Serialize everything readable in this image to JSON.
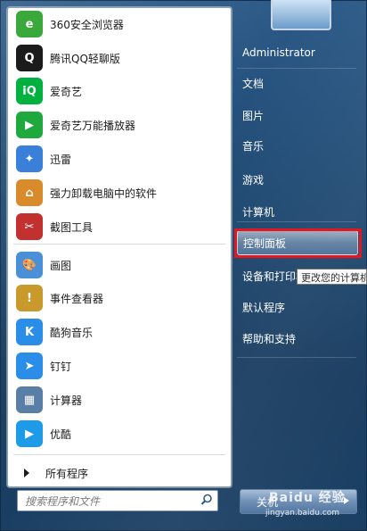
{
  "programs": [
    {
      "label": "360安全浏览器",
      "icon": "browser-360-icon",
      "color": "#3aa83a",
      "glyph": "e"
    },
    {
      "label": "腾讯QQ轻聊版",
      "icon": "qq-penguin-icon",
      "color": "#1b1b1b",
      "glyph": "Q"
    },
    {
      "label": "爱奇艺",
      "icon": "iqiyi-icon",
      "color": "#00b140",
      "glyph": "iQ"
    },
    {
      "label": "爱奇艺万能播放器",
      "icon": "iqiyi-player-icon",
      "color": "#1fa83c",
      "glyph": "▶"
    },
    {
      "label": "迅雷",
      "icon": "thunder-icon",
      "color": "#3a7fd8",
      "glyph": "✦"
    },
    {
      "label": "强力卸载电脑中的软件",
      "icon": "uninstall-icon",
      "color": "#d98a2a",
      "glyph": "⌂"
    },
    {
      "label": "截图工具",
      "icon": "snipping-tool-icon",
      "color": "#c23030",
      "glyph": "✂"
    },
    {
      "label": "画图",
      "icon": "paint-icon",
      "color": "#4a90d9",
      "glyph": "🎨"
    },
    {
      "label": "事件查看器",
      "icon": "event-viewer-icon",
      "color": "#c89a2c",
      "glyph": "!"
    },
    {
      "label": "酷狗音乐",
      "icon": "kugou-icon",
      "color": "#2a8de8",
      "glyph": "K"
    },
    {
      "label": "钉钉",
      "icon": "dingtalk-icon",
      "color": "#2a8de8",
      "glyph": "➤"
    },
    {
      "label": "计算器",
      "icon": "calculator-icon",
      "color": "#5a7fa6",
      "glyph": "▦"
    },
    {
      "label": "优酷",
      "icon": "youku-icon",
      "color": "#1e9be8",
      "glyph": "▶"
    }
  ],
  "all_programs": "所有程序",
  "search": {
    "placeholder": "搜索程序和文件"
  },
  "right_items": [
    {
      "label": "Administrator"
    },
    {
      "label": "文档"
    },
    {
      "label": "图片"
    },
    {
      "label": "音乐"
    },
    {
      "label": "游戏"
    },
    {
      "label": "计算机"
    },
    {
      "label": "控制面板"
    },
    {
      "label": "设备和打印机"
    },
    {
      "label": "默认程序"
    },
    {
      "label": "帮助和支持"
    }
  ],
  "tooltip": "更改您的计算机",
  "shutdown_label": "关机",
  "watermark": {
    "main": "Baidu 经验",
    "sub": "jingyan.baidu.com"
  }
}
